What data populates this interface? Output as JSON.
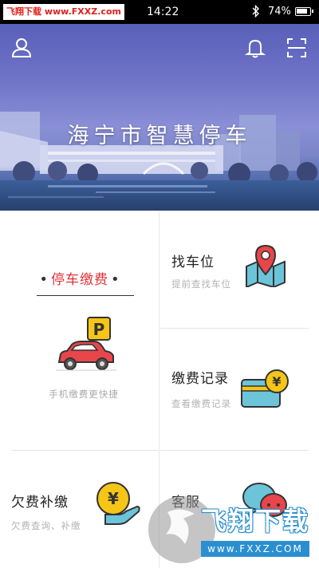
{
  "status_bar": {
    "watermark_text": "飞翔下载 www.FXXZ.com",
    "time": "14:22",
    "battery": "74%"
  },
  "header": {
    "title": "海宁市智慧停车",
    "icons": [
      "user-icon",
      "bell-icon",
      "scan-icon"
    ]
  },
  "tiles": {
    "pay": {
      "title": "停车缴费",
      "subtitle": "手机缴费更快捷",
      "badge": "P"
    },
    "find": {
      "title": "找车位",
      "subtitle": "提前查找车位"
    },
    "record": {
      "title": "缴费记录",
      "subtitle": "查看缴费记录",
      "symbol": "¥"
    },
    "debt": {
      "title": "欠费补缴",
      "subtitle": "欠费查询、补缴",
      "symbol": "¥"
    },
    "service": {
      "title": "客服"
    }
  },
  "watermark": {
    "brand": "飞翔下载",
    "url": "www.FXXZ.COM"
  },
  "colors": {
    "accent_red": "#e0323a",
    "watermark_blue": "#2a8fd0",
    "coin_yellow": "#f5c518"
  }
}
